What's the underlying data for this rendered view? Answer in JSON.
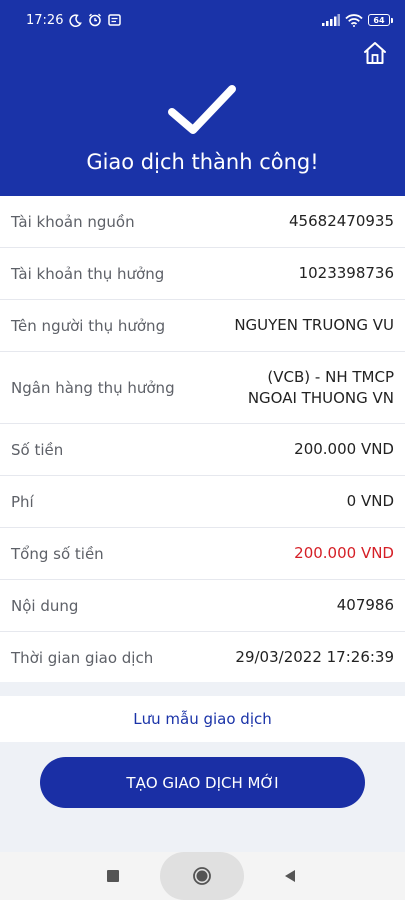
{
  "status_bar": {
    "time": "17:26",
    "battery": "64",
    "icons": [
      "moon-icon",
      "alarm-icon",
      "notification-icon",
      "signal-icon",
      "wifi-icon",
      "battery-icon"
    ]
  },
  "header": {
    "title": "Giao dịch thành công!",
    "home_icon": "home-icon",
    "check_icon": "checkmark-icon",
    "background": "#1a33a8"
  },
  "details": [
    {
      "label": "Tài khoản nguồn",
      "value": "45682470935"
    },
    {
      "label": "Tài khoản thụ hưởng",
      "value": "1023398736"
    },
    {
      "label": "Tên người thụ hưởng",
      "value": "NGUYEN TRUONG VU"
    },
    {
      "label": "Ngân hàng thụ hưởng",
      "value": "(VCB) - NH TMCP NGOAI THUONG VN"
    },
    {
      "label": "Số tiền",
      "value": "200.000 VND"
    },
    {
      "label": "Phí",
      "value": "0 VND"
    },
    {
      "label": "Tổng số tiền",
      "value": "200.000 VND",
      "color": "#d51f26"
    },
    {
      "label": "Nội dung",
      "value": "407986"
    },
    {
      "label": "Thời gian giao dịch",
      "value": "29/03/2022 17:26:39"
    }
  ],
  "actions": {
    "save_template": "Lưu mẫu giao dịch",
    "new_transaction": "TẠO GIAO DỊCH MỚI"
  },
  "navbar": {
    "items": [
      "recent-apps-icon",
      "home-icon",
      "back-icon"
    ]
  }
}
